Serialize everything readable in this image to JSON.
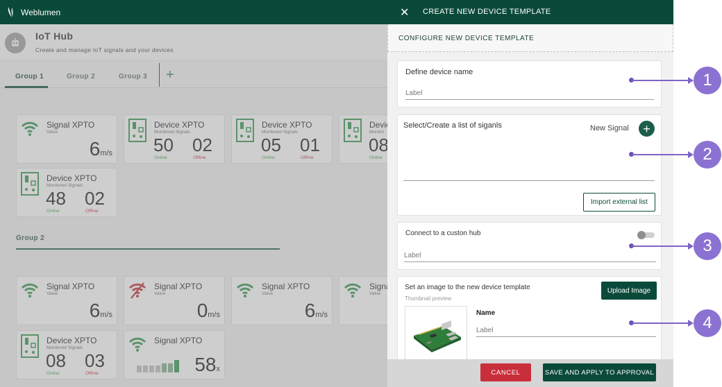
{
  "app": {
    "brand": "Weblumen",
    "title": "IoT Hub",
    "subtitle": "Create and manage IoT signals and your devices",
    "tabs": [
      "Group 1",
      "Group 2",
      "Group 3"
    ],
    "group2_label": "Group 2"
  },
  "cards": {
    "g1_signal": {
      "title": "Signal XPTO",
      "sub": "Value",
      "value": "6",
      "unit": "m/s"
    },
    "g1_device1": {
      "title": "Device XPTO",
      "sub": "Monitored Signals",
      "online": "50",
      "offline": "02",
      "online_label": "Online",
      "offline_label": "Offline"
    },
    "g1_device2": {
      "title": "Device XPTO",
      "sub": "Monitored Signals",
      "online": "05",
      "offline": "01",
      "online_label": "Online",
      "offline_label": "Offline"
    },
    "g1_device3": {
      "title": "Devic",
      "sub": "Monitor",
      "online": "08",
      "online_label": "Online"
    },
    "g1_device4": {
      "title": "Device XPTO",
      "sub": "Monitored Signals",
      "online": "48",
      "offline": "02",
      "online_label": "Online",
      "offline_label": "Offline"
    },
    "g2_signal1": {
      "title": "Signal XPTO",
      "sub": "Value",
      "value": "6",
      "unit": "m/s"
    },
    "g2_signal2": {
      "title": "Signal XPTO",
      "sub": "Value",
      "value": "0",
      "unit": "m/s"
    },
    "g2_signal3": {
      "title": "Signal XPTO",
      "sub": "Value",
      "value": "6",
      "unit": "m/s"
    },
    "g2_signal4": {
      "title": "Signa",
      "sub": "Value"
    },
    "g2_device1": {
      "title": "Device XPTO",
      "sub": "Monitored Signals",
      "online": "08",
      "offline": "03",
      "online_label": "Online",
      "offline_label": "Offline"
    },
    "g2_signal5": {
      "title": "Signal XPTO",
      "value": "58",
      "unit": "x",
      "bar_levels": [
        0.55,
        0.55,
        0.55,
        0.55,
        0.7,
        0.7,
        1.0
      ]
    }
  },
  "drawer": {
    "title": "CREATE NEW DEVICE TEMPLATE",
    "subtitle": "CONFIGURE NEW DEVICE TEMPLATE",
    "name_section": {
      "title": "Define device name",
      "placeholder": "Label"
    },
    "signals_section": {
      "title": "Select/Create a list of siganls",
      "new_signal": "New Signal",
      "import_button": "Import external list"
    },
    "hub_section": {
      "title": "Connect to a custon hub",
      "placeholder": "Label",
      "toggle_on": false
    },
    "image_section": {
      "title": "Set an image to the new device template",
      "thumb_caption": "Thumbnail preview",
      "upload_button": "Upload Image",
      "name_label": "Name",
      "name_placeholder": "Label"
    },
    "cancel": "CANCEL",
    "save": "SAVE  AND APPLY TO APPROVAL"
  },
  "callouts": [
    "1",
    "2",
    "3",
    "4"
  ],
  "colors": {
    "primary": "#0b4a3a",
    "danger": "#c92f3b",
    "online": "#3c9a43",
    "offline": "#c0303a",
    "callout": "#8b72d2"
  }
}
